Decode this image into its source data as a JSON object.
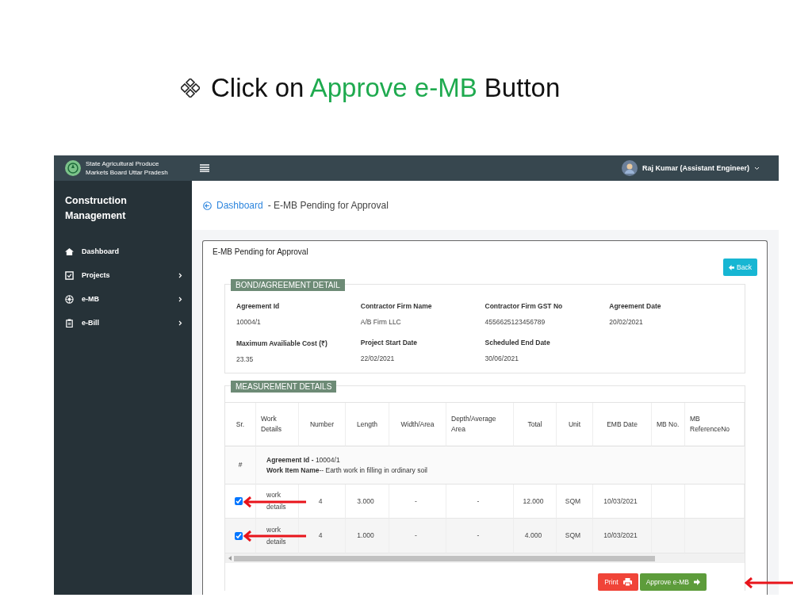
{
  "slide_title": {
    "before": "Click on",
    "highlight": "Approve e-MB",
    "after": "Button"
  },
  "topbar": {
    "org_name": [
      "State Agricultural Produce",
      "Markets Board Uttar Pradesh"
    ],
    "user": "Raj Kumar (Assistant Engineer)"
  },
  "sidebar": {
    "title": "Construction Management",
    "items": [
      {
        "label": "Dashboard",
        "kind": "home",
        "has_submenu": false
      },
      {
        "label": "Projects",
        "kind": "checklist",
        "has_submenu": true
      },
      {
        "label": "e-MB",
        "kind": "wheel",
        "has_submenu": true
      },
      {
        "label": "e-Bill",
        "kind": "clipboard",
        "has_submenu": true
      }
    ]
  },
  "breadcrumb": {
    "link": "Dashboard",
    "current": "- E-MB Pending for Approval"
  },
  "card": {
    "title": "E-MB Pending for Approval",
    "back_button": "Back"
  },
  "bond_section": {
    "legend": "BOND/AGREEMENT DETAIL",
    "fields": [
      {
        "label": "Agreement Id",
        "value": "10004/1"
      },
      {
        "label": "Contractor Firm Name",
        "value": "A/B Firm LLC"
      },
      {
        "label": "Contractor Firm GST No",
        "value": "4556625123456789"
      },
      {
        "label": "Agreement Date",
        "value": "20/02/2021"
      },
      {
        "label": "Maximum Availiable Cost (₹)",
        "value": "23.35"
      },
      {
        "label": "Project Start Date",
        "value": "22/02/2021"
      },
      {
        "label": "Scheduled End Date",
        "value": "30/06/2021"
      }
    ]
  },
  "measurement_section": {
    "legend": "MEASUREMENT DETAILS",
    "columns": [
      "Sr.",
      "Work Details",
      "Number",
      "Length",
      "Width/Area",
      "Depth/Average Area",
      "Total",
      "Unit",
      "EMB Date",
      "MB No.",
      "MB ReferenceNo"
    ],
    "group": {
      "sr": "#",
      "agreement": "**Agreement Id -** 10004/1",
      "work_item": "**Work Item Name**-- Earth work in filling in ordinary soil"
    },
    "rows": [
      {
        "checked": true,
        "cells": [
          "",
          "work details",
          "4",
          "3.000",
          "-",
          "-",
          "12.000",
          "SQM",
          "10/03/2021",
          "",
          ""
        ]
      },
      {
        "checked": true,
        "cells": [
          "",
          "work details",
          "4",
          "1.000",
          "-",
          "-",
          "4.000",
          "SQM",
          "10/03/2021",
          "",
          ""
        ]
      }
    ]
  },
  "actions": {
    "print": "Print",
    "approve": "Approve e-MB"
  }
}
